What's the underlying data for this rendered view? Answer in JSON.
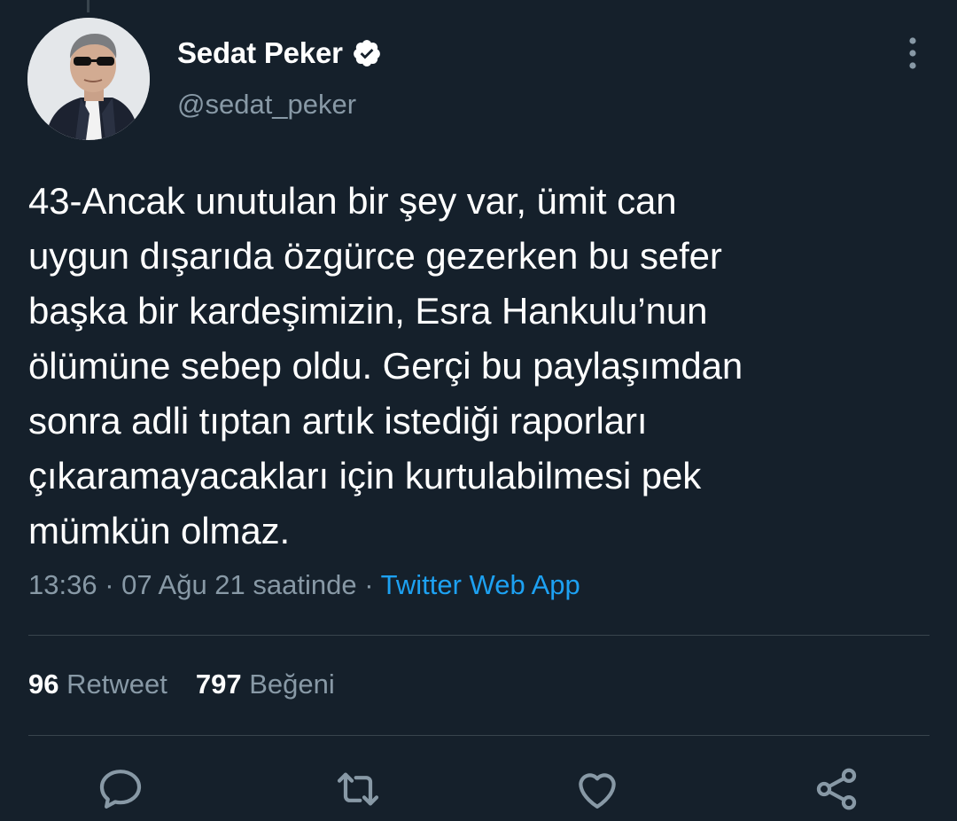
{
  "tweet": {
    "display_name": "Sedat Peker",
    "handle": "@sedat_peker",
    "text": "43-Ancak unutulan bir şey var, ümit can\nuygun dışarıda özgürce gezerken bu sefer\nbaşka bir kardeşimizin, Esra Hankulu’nun\nölümüne sebep oldu. Gerçi bu paylaşımdan\nsonra adli tıptan artık istediği raporları\nçıkaramayacakları için kurtulabilmesi pek\nmümkün olmaz.",
    "time": "13:36",
    "date": "07 Ağu 21 saatinde",
    "separator": "·",
    "source": "Twitter Web App"
  },
  "stats": {
    "retweet_count": "96",
    "retweet_label": "Retweet",
    "like_count": "797",
    "like_label": "Beğeni"
  },
  "icons": {
    "verified": "verified-badge-icon",
    "more": "more-vertical-icon",
    "reply": "reply-icon",
    "retweet": "retweet-icon",
    "like": "heart-icon",
    "share": "share-icon"
  },
  "colors": {
    "background": "#15202b",
    "secondary_text": "#8899a6",
    "link": "#1da1f2",
    "divider": "#38444d"
  }
}
